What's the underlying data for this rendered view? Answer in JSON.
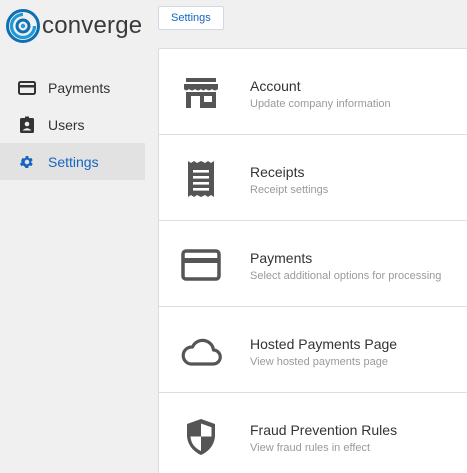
{
  "brand": {
    "name": "converge",
    "accent": "#1565c0"
  },
  "sidebar": {
    "items": [
      {
        "label": "Payments",
        "icon": "credit-card-icon",
        "active": false
      },
      {
        "label": "Users",
        "icon": "user-badge-icon",
        "active": false
      },
      {
        "label": "Settings",
        "icon": "gear-icon",
        "active": true
      }
    ]
  },
  "breadcrumb": {
    "label": "Settings"
  },
  "settings": {
    "cards": [
      {
        "title": "Account",
        "subtitle": "Update company information",
        "icon": "storefront-icon"
      },
      {
        "title": "Receipts",
        "subtitle": "Receipt settings",
        "icon": "receipt-icon"
      },
      {
        "title": "Payments",
        "subtitle": "Select additional options for processing",
        "icon": "credit-card-icon"
      },
      {
        "title": "Hosted Payments Page",
        "subtitle": "View hosted payments page",
        "icon": "cloud-icon"
      },
      {
        "title": "Fraud Prevention Rules",
        "subtitle": "View fraud rules in effect",
        "icon": "shield-icon"
      }
    ]
  }
}
